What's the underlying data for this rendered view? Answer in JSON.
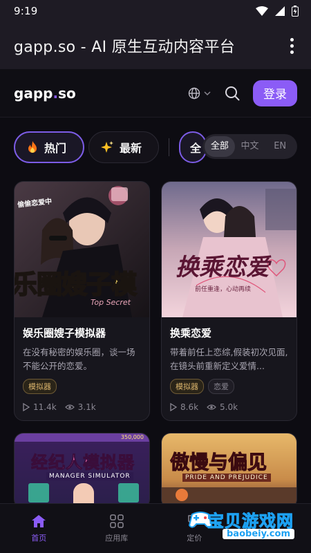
{
  "status_bar": {
    "time": "9:19"
  },
  "app_bar": {
    "title": "gapp.so - AI 原生互动内容平台"
  },
  "site_header": {
    "logo_main": "gapp",
    "logo_dot": ".",
    "logo_tail": "so",
    "login_label": "登录"
  },
  "filters": {
    "chips": [
      {
        "label": "热门",
        "icon": "fire-icon",
        "active": true
      },
      {
        "label": "最新",
        "icon": "sparkle-icon",
        "active": false
      },
      {
        "label": "全",
        "icon": "",
        "active": true
      }
    ],
    "languages": [
      "全部",
      "中文",
      "EN"
    ],
    "selected_language": "全部"
  },
  "cards": [
    {
      "title": "娱乐圈嫂子模拟器",
      "description": "在没有秘密的娱乐圈，谈一场不能公开的恋爱。",
      "tags": [
        "模拟器"
      ],
      "plays": "11.4k",
      "views": "3.1k",
      "cover_text": "乐圈嫂子模",
      "cover_subtext": "Top Secret",
      "cover_badge": "偷偷恋爱中"
    },
    {
      "title": "换乘恋爱",
      "description": "带着前任上恋综,假装初次见面,在镜头前重新定义爱情...",
      "tags": [
        "模拟器",
        "恋爱"
      ],
      "plays": "8.6k",
      "views": "5.0k",
      "cover_text": "换乘恋爱",
      "cover_subtext": "前任重逢，心动再续"
    },
    {
      "title": "",
      "cover_text": "经纪人模拟器",
      "cover_subtext": "MANAGER SIMULATOR",
      "cover_money": "350,000"
    },
    {
      "title": "",
      "cover_text": "傲慢与偏见",
      "cover_subtext": "PRIDE AND PREJUDICE"
    }
  ],
  "bottom_nav": [
    {
      "label": "首页",
      "icon": "home-icon",
      "active": true
    },
    {
      "label": "应用库",
      "icon": "grid-icon",
      "active": false
    },
    {
      "label": "定价",
      "icon": "tag-icon",
      "active": false
    }
  ],
  "watermark": {
    "text": "宝贝游戏网",
    "sub": "baobeiy.com"
  },
  "colors": {
    "accent": "#8b5cf6",
    "background": "#0d0c12",
    "tag_gold": "#d9b36b"
  }
}
